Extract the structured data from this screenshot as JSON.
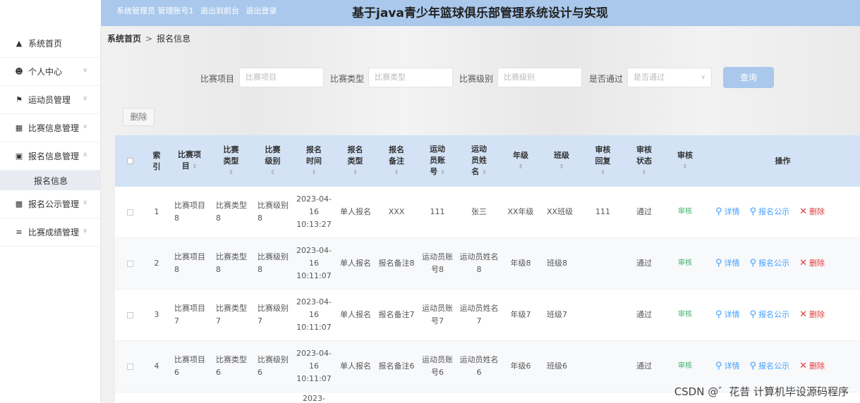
{
  "header": {
    "user_info": [
      "系统管理员 管理账号1",
      "退出到前台",
      "退出登录"
    ],
    "title": "基于java青少年篮球俱乐部管理系统设计与实现"
  },
  "sidebar": {
    "items": [
      {
        "label": "系统首页",
        "icon": "home-icon",
        "has_children": false
      },
      {
        "label": "个人中心",
        "icon": "person-icon",
        "has_children": true
      },
      {
        "label": "运动员管理",
        "icon": "flag-icon",
        "has_children": true
      },
      {
        "label": "比赛信息管理",
        "icon": "calendar-icon",
        "has_children": true
      },
      {
        "label": "报名信息管理",
        "icon": "monitor-icon",
        "has_children": true,
        "expanded": true
      },
      {
        "label": "报名公示管理",
        "icon": "grid-icon",
        "has_children": true
      },
      {
        "label": "比赛成绩管理",
        "icon": "sliders-icon",
        "has_children": true
      }
    ],
    "submenu": {
      "label": "报名信息"
    }
  },
  "breadcrumb": {
    "home": "系统首页",
    "separator": ">",
    "current": "报名信息"
  },
  "search": {
    "fields": [
      {
        "label": "比赛项目",
        "placeholder": "比赛项目"
      },
      {
        "label": "比赛类型",
        "placeholder": "比赛类型"
      },
      {
        "label": "比赛级别",
        "placeholder": "比赛级别"
      },
      {
        "label": "是否通过",
        "placeholder": "是否通过"
      }
    ],
    "button": "查询"
  },
  "actions": {
    "delete": "删除"
  },
  "table": {
    "headers": [
      {
        "lines": [
          "索",
          "引"
        ],
        "sort": false
      },
      {
        "lines": [
          "比赛项",
          "目"
        ],
        "sort": true
      },
      {
        "lines": [
          "比赛",
          "类型"
        ],
        "sort": true
      },
      {
        "lines": [
          "比赛",
          "级别"
        ],
        "sort": true
      },
      {
        "lines": [
          "报名",
          "时间"
        ],
        "sort": true
      },
      {
        "lines": [
          "报名",
          "类型"
        ],
        "sort": true
      },
      {
        "lines": [
          "报名",
          "备注"
        ],
        "sort": true
      },
      {
        "lines": [
          "运动",
          "员账",
          "号"
        ],
        "sort": true
      },
      {
        "lines": [
          "运动",
          "员姓",
          "名"
        ],
        "sort": true
      },
      {
        "lines": [
          "年级"
        ],
        "sort": true
      },
      {
        "lines": [
          "班级"
        ],
        "sort": true
      },
      {
        "lines": [
          "审核",
          "回复"
        ],
        "sort": true
      },
      {
        "lines": [
          "审核",
          "状态"
        ],
        "sort": true
      },
      {
        "lines": [
          "审核"
        ],
        "sort": true
      },
      {
        "lines": [
          "操作"
        ],
        "sort": false
      }
    ],
    "rows": [
      {
        "index": "1",
        "item": "比赛项目8",
        "type": "比赛类型8",
        "level": "比赛级别8",
        "time": "2023-04-16 10:13:27",
        "signup_type": "单人报名",
        "note": "XXX",
        "account": "111",
        "name": "张三",
        "grade": "XX年级",
        "class": "XX班级",
        "reply": "111",
        "status": "通过",
        "audit": "审核"
      },
      {
        "index": "2",
        "item": "比赛项目8",
        "type": "比赛类型8",
        "level": "比赛级别8",
        "time": "2023-04-16 10:11:07",
        "signup_type": "单人报名",
        "note": "报名备注8",
        "account": "运动员账号8",
        "name": "运动员姓名8",
        "grade": "年级8",
        "class": "班级8",
        "reply": "",
        "status": "通过",
        "audit": "审核"
      },
      {
        "index": "3",
        "item": "比赛项目7",
        "type": "比赛类型7",
        "level": "比赛级别7",
        "time": "2023-04-16 10:11:07",
        "signup_type": "单人报名",
        "note": "报名备注7",
        "account": "运动员账号7",
        "name": "运动员姓名7",
        "grade": "年级7",
        "class": "班级7",
        "reply": "",
        "status": "通过",
        "audit": "审核"
      },
      {
        "index": "4",
        "item": "比赛项目6",
        "type": "比赛类型6",
        "level": "比赛级别6",
        "time": "2023-04-16 10:11:07",
        "signup_type": "单人报名",
        "note": "报名备注6",
        "account": "运动员账号6",
        "name": "运动员姓名6",
        "grade": "年级6",
        "class": "班级6",
        "reply": "",
        "status": "通过",
        "audit": "审核"
      }
    ],
    "ops": {
      "detail": "详情",
      "publish": "报名公示",
      "delete": "删除"
    },
    "partial_row_time": "2023-"
  },
  "watermark": "CSDN @゛花昔 计算机毕设源码程序"
}
